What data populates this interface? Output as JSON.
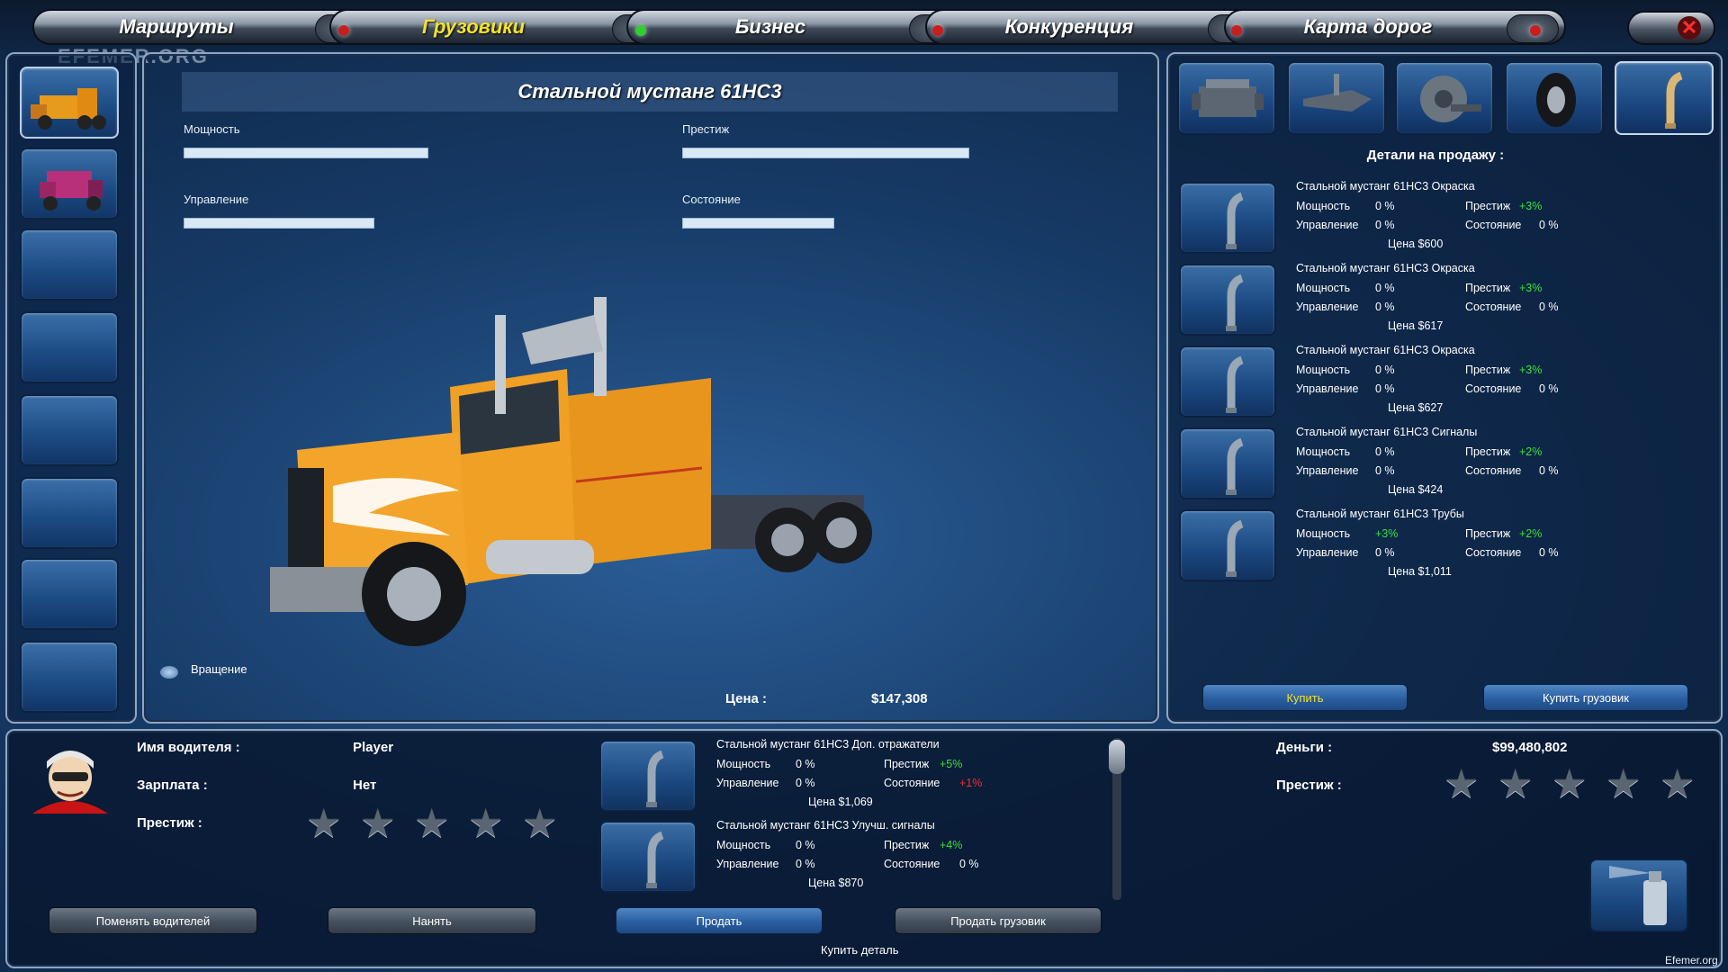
{
  "nav": {
    "tabs": [
      {
        "label": "Маршруты",
        "led": "#c81e1e"
      },
      {
        "label": "Грузовики",
        "led": "#2ed02e",
        "active": true
      },
      {
        "label": "Бизнес",
        "led": "#c81e1e"
      },
      {
        "label": "Конкуренция",
        "led": "#c81e1e"
      },
      {
        "label": "Карта дорог",
        "led": "#c81e1e"
      }
    ],
    "close_glyph": "✕",
    "close_icon": "close-icon"
  },
  "watermark_top": "EFEMER.ORG",
  "left_rail": {
    "slots": [
      {
        "icon": "orange-truck-icon",
        "filled": true
      },
      {
        "icon": "purple-truck-icon",
        "filled": true
      },
      {
        "filled": false
      },
      {
        "filled": false
      },
      {
        "filled": false
      },
      {
        "filled": false
      },
      {
        "filled": false
      },
      {
        "filled": false
      }
    ]
  },
  "truck": {
    "title": "Стальной мустанг 61НС3",
    "stats": [
      {
        "label": "Мощность",
        "level": 0.82
      },
      {
        "label": "Престиж",
        "level": 0.96
      },
      {
        "label": "Управление",
        "level": 0.64
      },
      {
        "label": "Состояние",
        "level": 0.51
      }
    ],
    "rotate_label": "Вращение",
    "price_label": "Цена :",
    "price_value": "$147,308"
  },
  "parts_panel": {
    "category_icons": [
      "engine-icon",
      "transmission-icon",
      "brake-icon",
      "tire-icon",
      "exhaust-pipe-icon"
    ],
    "heading": "Детали на продажу :",
    "items": [
      {
        "name": "Стальной мустанг 61НС3 Окраска",
        "power_label": "Мощность",
        "power": "0 %",
        "prestige_label": "Престиж",
        "prestige": "+3%",
        "prestige_color": "#35e23a",
        "handling_label": "Управление",
        "handling": "0 %",
        "condition_label": "Состояние",
        "condition": "0 %",
        "price": "Цена $600"
      },
      {
        "name": "Стальной мустанг 61НС3 Окраска",
        "power_label": "Мощность",
        "power": "0 %",
        "prestige_label": "Престиж",
        "prestige": "+3%",
        "prestige_color": "#35e23a",
        "handling_label": "Управление",
        "handling": "0 %",
        "condition_label": "Состояние",
        "condition": "0 %",
        "price": "Цена $617"
      },
      {
        "name": "Стальной мустанг 61НС3 Окраска",
        "power_label": "Мощность",
        "power": "0 %",
        "prestige_label": "Престиж",
        "prestige": "+3%",
        "prestige_color": "#35e23a",
        "handling_label": "Управление",
        "handling": "0 %",
        "condition_label": "Состояние",
        "condition": "0 %",
        "price": "Цена $627"
      },
      {
        "name": "Стальной мустанг 61НС3 Сигналы",
        "power_label": "Мощность",
        "power": "0 %",
        "prestige_label": "Престиж",
        "prestige": "+2%",
        "prestige_color": "#35e23a",
        "handling_label": "Управление",
        "handling": "0 %",
        "condition_label": "Состояние",
        "condition": "0 %",
        "price": "Цена $424"
      },
      {
        "name": "Стальной мустанг 61НС3 Трубы",
        "power_label": "Мощность",
        "power": "+3%",
        "power_color": "#35e23a",
        "prestige_label": "Престиж",
        "prestige": "+2%",
        "prestige_color": "#35e23a",
        "handling_label": "Управление",
        "handling": "0 %",
        "condition_label": "Состояние",
        "condition": "0 %",
        "price": "Цена $1,011"
      }
    ],
    "buy_label": "Купить",
    "buy_truck_label": "Купить грузовик"
  },
  "driver": {
    "name_label": "Имя водителя :",
    "name_value": "Player",
    "salary_label": "Зарплата :",
    "salary_value": "Нет",
    "prestige_label": "Престиж :",
    "prestige_stars": 0,
    "prestige_max": 5,
    "avatar_icon": "driver-avatar-icon",
    "change_label": "Поменять водителей",
    "hire_label": "Нанять"
  },
  "installed_parts": {
    "items": [
      {
        "name": "Стальной мустанг 61НС3 Доп. отражатели",
        "power_label": "Мощность",
        "power": "0 %",
        "prestige_label": "Престиж",
        "prestige": "+5%",
        "prestige_color": "#35e23a",
        "handling_label": "Управление",
        "handling": "0 %",
        "condition_label": "Состояние",
        "condition": "+1%",
        "condition_color": "#ff2b2b",
        "price": "Цена $1,069"
      },
      {
        "name": "Стальной мустанг 61НС3 Улучш. сигналы",
        "power_label": "Мощность",
        "power": "0 %",
        "prestige_label": "Престиж",
        "prestige": "+4%",
        "prestige_color": "#35e23a",
        "handling_label": "Управление",
        "handling": "0 %",
        "condition_label": "Состояние",
        "condition": "0 %",
        "price": "Цена $870"
      }
    ],
    "sell_label": "Продать",
    "sell_truck_label": "Продать грузовик",
    "buy_part_label": "Купить деталь"
  },
  "company": {
    "money_label": "Деньги :",
    "money_value": "$99,480,802",
    "prestige_label": "Престиж :",
    "prestige_stars": 0,
    "prestige_max": 5
  },
  "paint_icon": "paint-can-icon",
  "watermark_bottom": "Efemer.org"
}
